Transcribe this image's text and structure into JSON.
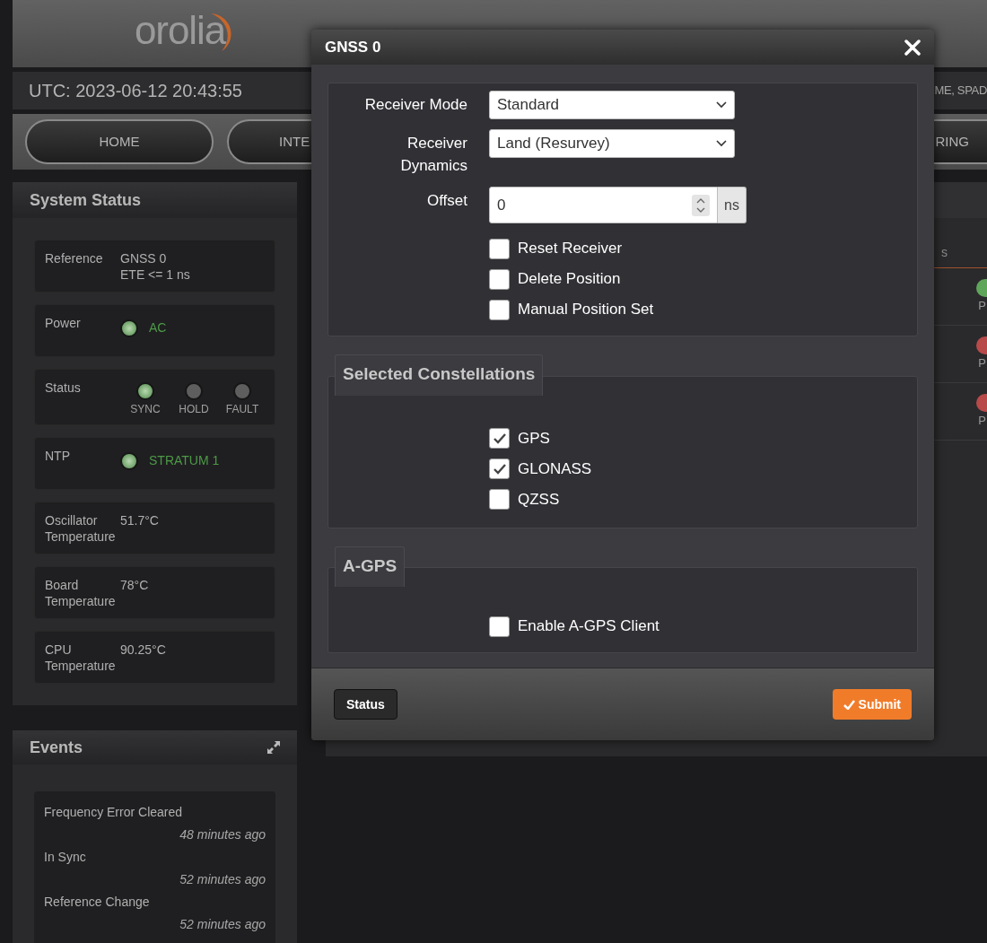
{
  "header": {
    "logo": "orolia",
    "utc": "UTC: 2023-06-12 20:43:55",
    "info_partial": "ME, SPAD"
  },
  "nav": [
    {
      "label": "HOME"
    },
    {
      "label": "INTE"
    },
    {
      "label": "RING"
    }
  ],
  "system_status": {
    "title": "System Status",
    "rows": [
      {
        "kind": "text",
        "label": "Reference",
        "values": [
          "GNSS 0",
          "ETE <= 1 ns"
        ]
      },
      {
        "kind": "led",
        "label": "Power",
        "value": "AC",
        "on": true
      },
      {
        "kind": "leds",
        "label": "Status",
        "leds": [
          {
            "label": "SYNC",
            "on": true
          },
          {
            "label": "HOLD",
            "on": false
          },
          {
            "label": "FAULT",
            "on": false
          }
        ]
      },
      {
        "kind": "led",
        "label": "NTP",
        "value": "STRATUM 1",
        "on": true
      },
      {
        "kind": "text",
        "label": "Oscillator Temperature",
        "values": [
          "51.7°C"
        ]
      },
      {
        "kind": "text",
        "label": "Board Temperature",
        "values": [
          "78°C"
        ]
      },
      {
        "kind": "text",
        "label": "CPU Temperature",
        "values": [
          "90.25°C"
        ]
      }
    ]
  },
  "events": {
    "title": "Events",
    "items": [
      {
        "text": "Frequency Error Cleared",
        "time": "48 minutes ago"
      },
      {
        "text": "In Sync",
        "time": "52 minutes ago"
      },
      {
        "text": "Reference Change",
        "time": "52 minutes ago"
      }
    ]
  },
  "background_panel": {
    "header_partial": "s",
    "indicators": [
      {
        "color": "#5fa65a",
        "label": "P"
      },
      {
        "color": "#b84a4a",
        "label": "P"
      },
      {
        "color": "#b84a4a",
        "label": "P"
      }
    ]
  },
  "modal": {
    "title": "GNSS 0",
    "fields": [
      {
        "kind": "select",
        "label": "Receiver Mode",
        "value": "Standard"
      },
      {
        "kind": "select",
        "label": "Receiver Dynamics",
        "value": "Land (Resurvey)"
      },
      {
        "kind": "number",
        "label": "Offset",
        "value": "0",
        "unit": "ns"
      },
      {
        "kind": "checkbox",
        "label": "Reset Receiver",
        "checked": false
      },
      {
        "kind": "checkbox",
        "label": "Delete Position",
        "checked": false
      },
      {
        "kind": "checkbox",
        "label": "Manual Position Set",
        "checked": false
      }
    ],
    "sections": [
      {
        "title": "Selected Constellations",
        "options": [
          {
            "label": "GPS",
            "checked": true
          },
          {
            "label": "GLONASS",
            "checked": true
          },
          {
            "label": "QZSS",
            "checked": false
          }
        ]
      },
      {
        "title": "A-GPS",
        "options": [
          {
            "label": "Enable A-GPS Client",
            "checked": false
          }
        ]
      }
    ],
    "status_button": "Status",
    "submit_button": "Submit"
  }
}
